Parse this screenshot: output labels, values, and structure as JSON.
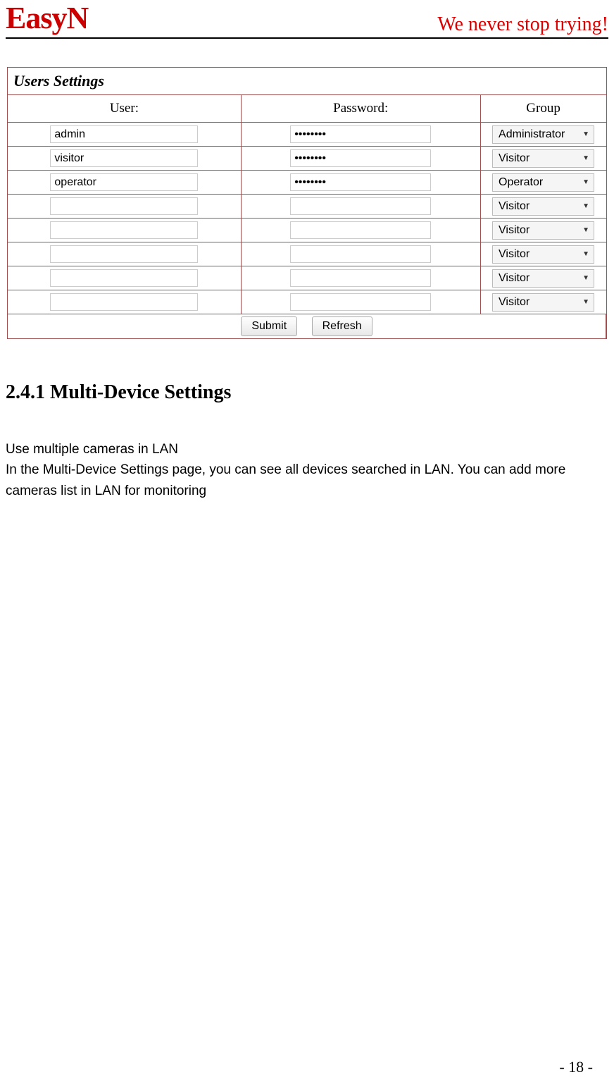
{
  "header": {
    "logo": "EasyN",
    "tagline": "We never stop trying!"
  },
  "panel": {
    "title": "Users Settings",
    "columns": {
      "user": "User:",
      "password": "Password:",
      "group": "Group"
    },
    "rows": [
      {
        "user": "admin",
        "password": "••••••••",
        "group": "Administrator"
      },
      {
        "user": "visitor",
        "password": "••••••••",
        "group": "Visitor"
      },
      {
        "user": "operator",
        "password": "••••••••",
        "group": "Operator"
      },
      {
        "user": "",
        "password": "",
        "group": "Visitor"
      },
      {
        "user": "",
        "password": "",
        "group": "Visitor"
      },
      {
        "user": "",
        "password": "",
        "group": "Visitor"
      },
      {
        "user": "",
        "password": "",
        "group": "Visitor"
      },
      {
        "user": "",
        "password": "",
        "group": "Visitor"
      }
    ],
    "buttons": {
      "submit": "Submit",
      "refresh": "Refresh"
    }
  },
  "section": {
    "heading": "2.4.1 Multi-Device Settings",
    "para1": "Use multiple cameras in LAN",
    "para2": "In the Multi-Device Settings page, you can see all devices searched in LAN. You can add more cameras list in LAN for monitoring"
  },
  "page_number": "- 18 -"
}
